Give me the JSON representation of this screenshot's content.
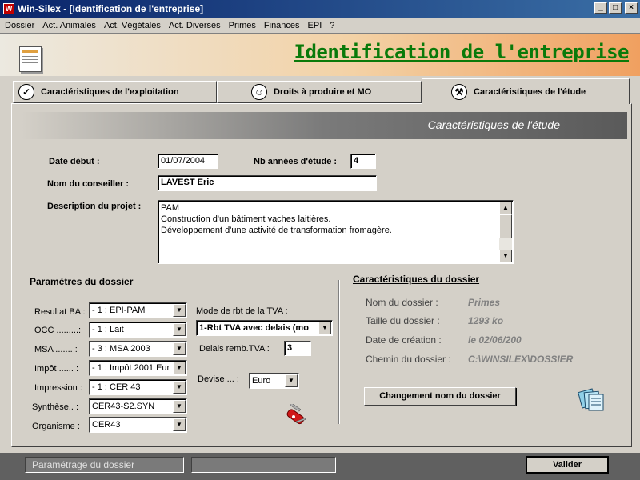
{
  "window": {
    "title": "Win-Silex - [Identification de l'entreprise]"
  },
  "menu": [
    "Dossier",
    "Act. Animales",
    "Act. Végétales",
    "Act. Diverses",
    "Primes",
    "Finances",
    "EPI",
    "?"
  ],
  "header": {
    "title": "Identification de l'entreprise"
  },
  "tabs": [
    {
      "label": "Caractéristiques de l'exploitation",
      "icon": "check-icon"
    },
    {
      "label": "Droits à produire et MO",
      "icon": "person-icon"
    },
    {
      "label": "Caractéristiques de l'étude",
      "icon": "wrench-icon"
    }
  ],
  "section": {
    "title": "Caractéristiques de l'étude"
  },
  "study": {
    "date_label": "Date début :",
    "date_value": "01/07/2004",
    "years_label": "Nb années d'étude :",
    "years_value": "4",
    "advisor_label": "Nom du conseiller :",
    "advisor_value": "LAVEST Eric",
    "desc_label": "Description du projet :",
    "desc_lines": [
      "PAM",
      "Construction d'un bâtiment vaches laitières.",
      "Développement d'une activité de transformation fromagère."
    ]
  },
  "params": {
    "title": "Paramètres du dossier",
    "rows": [
      {
        "label": "Resultat BA :",
        "value": "- 1 : EPI-PAM"
      },
      {
        "label": "OCC .........:",
        "value": "- 1 : Lait"
      },
      {
        "label": "MSA ....... :",
        "value": "- 3 : MSA 2003"
      },
      {
        "label": "Impôt ...... :",
        "value": "- 1 : Impôt 2001 Eur"
      },
      {
        "label": "Impression :",
        "value": "- 1 : CER 43"
      },
      {
        "label": "Synthèse.. :",
        "value": "CER43-S2.SYN"
      },
      {
        "label": "Organisme :",
        "value": "CER43"
      }
    ],
    "tva_mode_label": "Mode de rbt de la TVA :",
    "tva_mode_value": "1-Rbt TVA avec delais (mo",
    "tva_delay_label": "Delais remb.TVA :",
    "tva_delay_value": "3",
    "currency_label": "Devise ... :",
    "currency_value": "Euro"
  },
  "dossier": {
    "title": "Caractéristiques du dossier",
    "rows": [
      {
        "label": "Nom du dossier :",
        "value": "Primes"
      },
      {
        "label": "Taille du dossier :",
        "value": "1293 ko"
      },
      {
        "label": "Date de création :",
        "value": "le 02/06/200"
      },
      {
        "label": "Chemin du dossier :",
        "value": "C:\\WINSILEX\\DOSSIER"
      }
    ],
    "rename_button": "Changement nom du dossier"
  },
  "status": {
    "panel1": "Paramétrage du dossier",
    "panel2": "",
    "validate_button": "Valider"
  }
}
